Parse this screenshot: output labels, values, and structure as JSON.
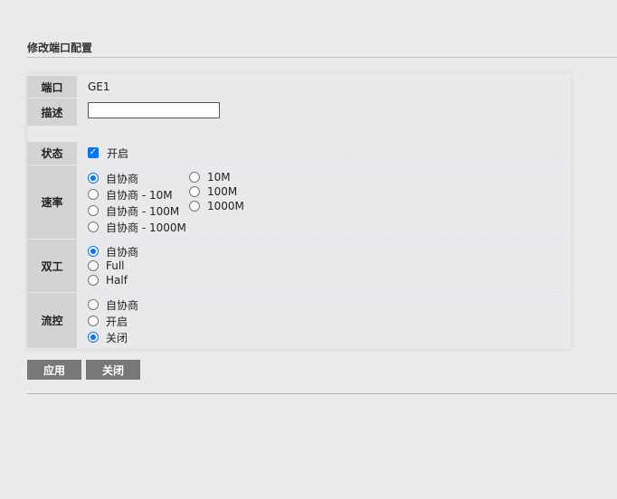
{
  "page_title": "修改端口配置",
  "fields": {
    "port": {
      "label": "端口",
      "value": "GE1"
    },
    "description": {
      "label": "描述",
      "value": ""
    },
    "status": {
      "label": "状态",
      "checkbox_label": "开启",
      "checked": true
    },
    "speed": {
      "label": "速率",
      "options": [
        "自协商",
        "自协商 - 10M",
        "自协商 - 100M",
        "自协商 - 1000M",
        "10M",
        "100M",
        "1000M"
      ],
      "selected": "自协商"
    },
    "duplex": {
      "label": "双工",
      "options": [
        "自协商",
        "Full",
        "Half"
      ],
      "selected": "自协商"
    },
    "flow_control": {
      "label": "流控",
      "options": [
        "自协商",
        "开启",
        "关闭"
      ],
      "selected": "关闭"
    }
  },
  "buttons": {
    "apply": "应用",
    "close": "关闭"
  },
  "colors": {
    "accent": "#0075ff",
    "button_bg": "#777777",
    "label_bg": "#d3d3d3"
  }
}
